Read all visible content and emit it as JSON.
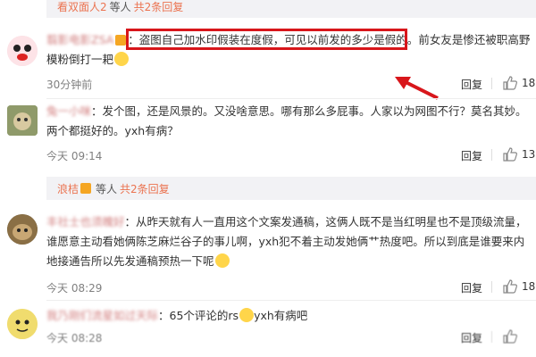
{
  "top_reply_band": {
    "user": "看双面人2",
    "text": "等人",
    "link": "共2条回复"
  },
  "comments": [
    {
      "user": "翦影电影ZSA",
      "text_highlighted": "盗图自己加水印假装在度假，可见以前发的多少是假的。",
      "text_rest": "前女友是惨还被职高野",
      "text_line2": "模粉倒打一耙",
      "time": "30分钟前",
      "reply": "回复",
      "likes": "18"
    },
    {
      "user": "兔一小咪",
      "text_line1": "：发个图，还是风景的。又没啥意思。哪有那么多屁事。人家以为网图不行？莫名其妙。",
      "text_line2": "两个都挺好的。yxh有病？",
      "time": "今天 09:14",
      "reply": "回复",
      "likes": "13"
    },
    {
      "user": "丰社士也须魄好",
      "text_line1": "：从昨天就有人一直用这个文案发通稿，这俩人既不是当红明星也不是顶级流量，",
      "text_line2": "谁愿意主动看她俩陈芝麻烂谷子的事儿啊，yxh犯不着主动发她俩艹热度吧。所以到底是谁要来内",
      "text_line3": "地接通告所以先发通稿预热一下呢",
      "time": "今天 08:29",
      "reply": "回复",
      "likes": "18"
    },
    {
      "user": "我乃刚们流星如过天际",
      "text_line1": "：65个评论的rs",
      "text_after_emoji": "yxh有病吧",
      "time": "今天 08:28",
      "reply": "回复"
    }
  ],
  "mid_reply_band": {
    "user": "浪桔",
    "text": "等人",
    "link": "共2条回复"
  },
  "colors": {
    "accent": "#eb7350",
    "highlight": "#d8161b",
    "arrow": "#d8161b"
  }
}
